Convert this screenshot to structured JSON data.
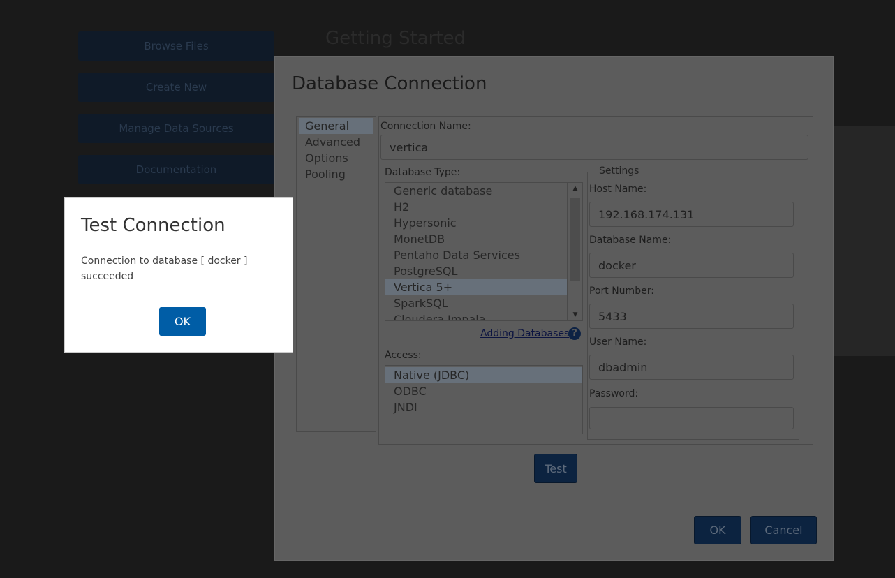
{
  "background": {
    "sidebar_buttons": [
      "Browse Files",
      "Create New",
      "Manage Data Sources",
      "Documentation"
    ],
    "page_title": "Getting Started"
  },
  "dialog": {
    "title": "Database Connection",
    "nav": [
      "General",
      "Advanced",
      "Options",
      "Pooling"
    ],
    "selected_nav": "General",
    "connection_name_label": "Connection Name:",
    "connection_name_value": "vertica",
    "database_type_label": "Database Type:",
    "database_types": [
      "Generic database",
      "H2",
      "Hypersonic",
      "MonetDB",
      "Pentaho Data Services",
      "PostgreSQL",
      "Vertica 5+",
      "SparkSQL",
      "Cloudera Impala"
    ],
    "selected_database_type": "Vertica 5+",
    "adding_databases_link": "Adding Databases",
    "help_icon_glyph": "?",
    "access_label": "Access:",
    "access_options": [
      "Native (JDBC)",
      "ODBC",
      "JNDI"
    ],
    "selected_access": "Native (JDBC)",
    "settings": {
      "legend": "Settings",
      "host_name_label": "Host Name:",
      "host_name_value": "192.168.174.131",
      "database_name_label": "Database Name:",
      "database_name_value": "docker",
      "port_number_label": "Port Number:",
      "port_number_value": "5433",
      "user_name_label": "User Name:",
      "user_name_value": "dbadmin",
      "password_label": "Password:",
      "password_value": ""
    },
    "test_button": "Test",
    "ok_button": "OK",
    "cancel_button": "Cancel"
  },
  "popup": {
    "title": "Test Connection",
    "message": "Connection to database [ docker ] succeeded",
    "ok_button": "OK"
  },
  "colors": {
    "primary_button": "#005da6",
    "overlay_dim": "#1a1a1a"
  }
}
